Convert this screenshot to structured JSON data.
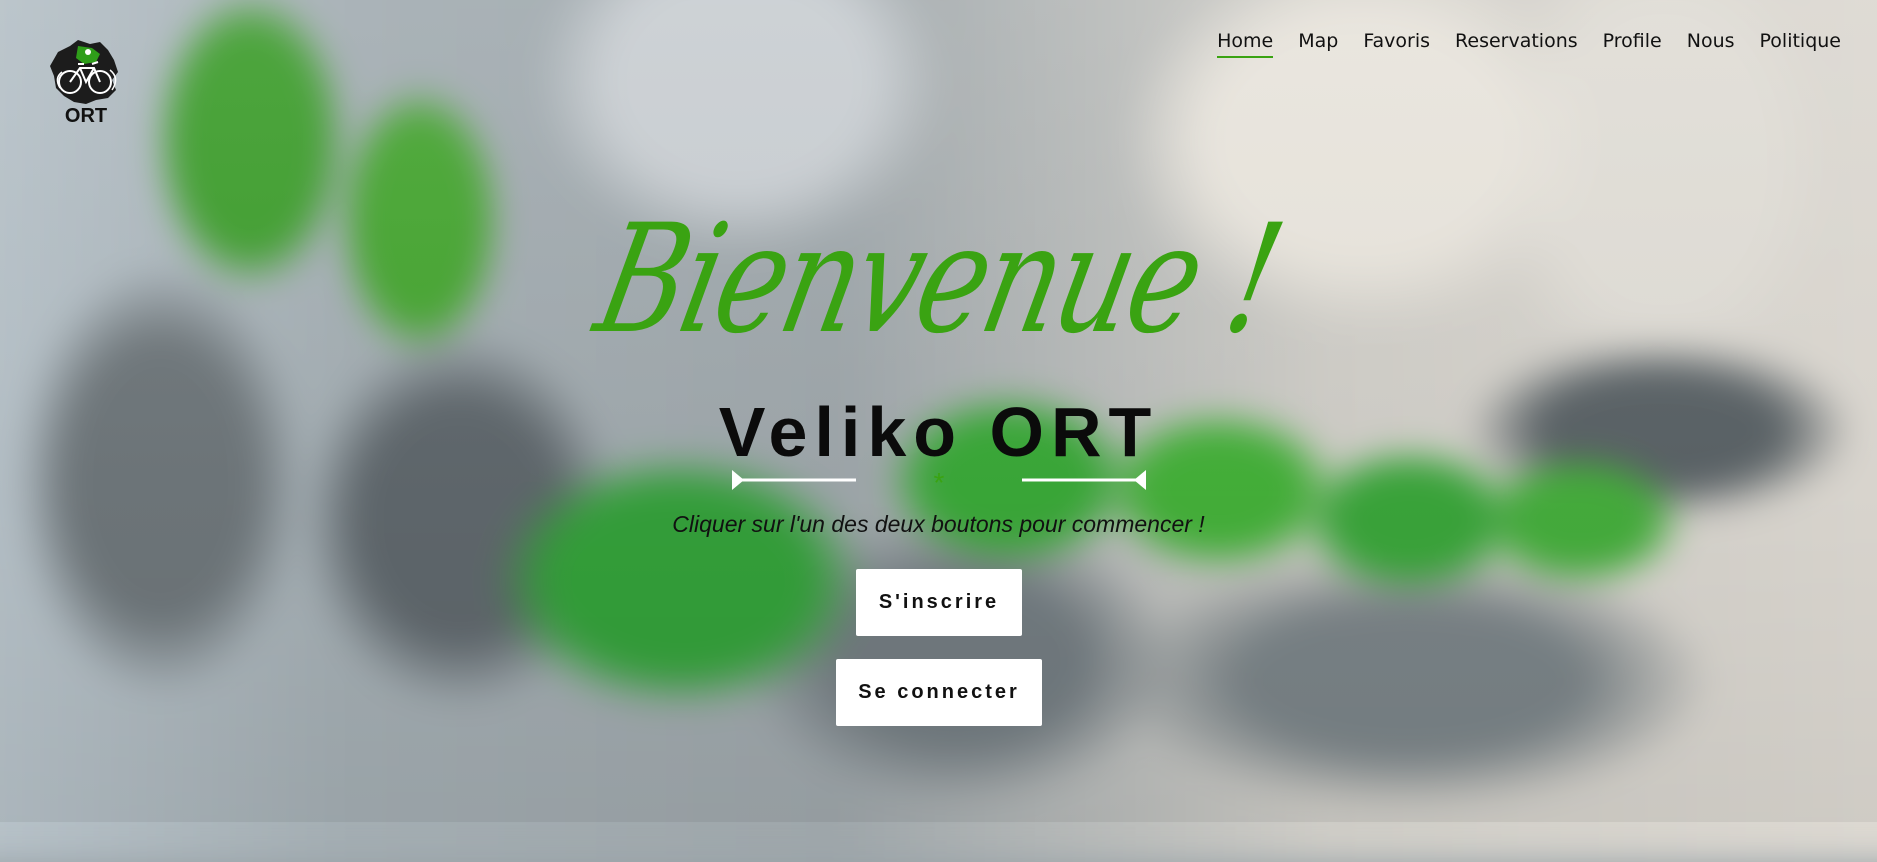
{
  "logo": {
    "text": "ORT",
    "icon": "bike-logo-icon"
  },
  "nav": {
    "items": [
      {
        "label": "Home",
        "active": true
      },
      {
        "label": "Map",
        "active": false
      },
      {
        "label": "Favoris",
        "active": false
      },
      {
        "label": "Reservations",
        "active": false
      },
      {
        "label": "Profile",
        "active": false
      },
      {
        "label": "Nous",
        "active": false
      },
      {
        "label": "Politique",
        "active": false
      }
    ]
  },
  "hero": {
    "welcome": "Bienvenue !",
    "title": "Veliko ORT",
    "divider_symbol": "*",
    "subtitle": "Cliquer sur l'un des deux boutons pour commencer !",
    "signup_label": "S'inscrire",
    "login_label": "Se connecter"
  },
  "colors": {
    "accent": "#3aa312",
    "text": "#111111",
    "button_bg": "#ffffff"
  }
}
